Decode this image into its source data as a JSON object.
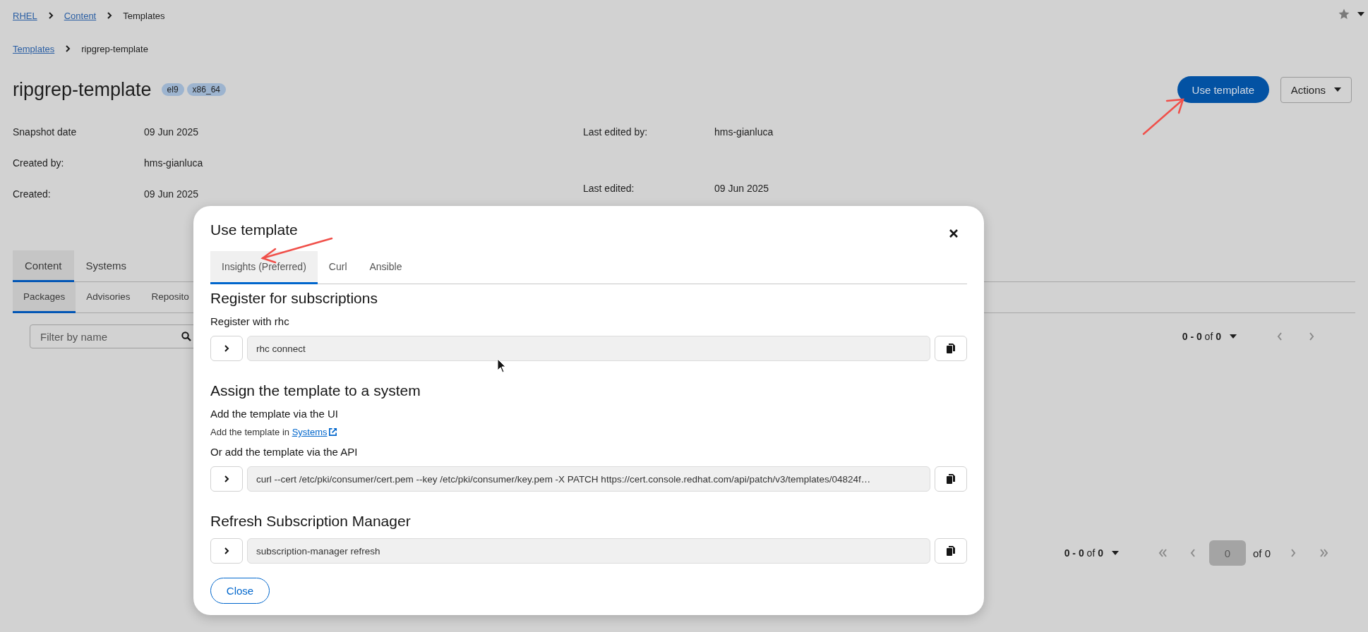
{
  "breadcrumb": [
    {
      "label": "RHEL",
      "link": true
    },
    {
      "label": "Content",
      "link": true
    },
    {
      "label": "Templates",
      "link": false
    }
  ],
  "sub_breadcrumb": [
    {
      "label": "Templates",
      "link": true
    },
    {
      "label": "ripgrep-template",
      "link": false
    }
  ],
  "header": {
    "title": "ripgrep-template",
    "tags": [
      "el9",
      "x86_64"
    ],
    "primary_button": "Use template",
    "actions_button": "Actions"
  },
  "details_left": [
    {
      "label": "Snapshot date",
      "value": "09 Jun 2025"
    },
    {
      "label": "Created by:",
      "value": "hms-gianluca"
    },
    {
      "label": "Created:",
      "value": "09 Jun 2025"
    }
  ],
  "details_right": [
    {
      "label": "Last edited by:",
      "value": "hms-gianluca"
    },
    {
      "label": "Last edited:",
      "value": "09 Jun 2025"
    }
  ],
  "tabs": [
    {
      "label": "Content",
      "selected": true
    },
    {
      "label": "Systems",
      "selected": false
    }
  ],
  "subtabs": [
    {
      "label": "Packages",
      "selected": true
    },
    {
      "label": "Advisories",
      "selected": false
    },
    {
      "label": "Reposito",
      "selected": false
    }
  ],
  "filter": {
    "placeholder": "Filter by name"
  },
  "top_pagination": {
    "range": "**0 - 0** of **0**",
    "buttons": [
      {
        "kind": "prev",
        "disabled": true
      },
      {
        "kind": "next",
        "disabled": true
      }
    ]
  },
  "bottom_pagination": {
    "range": "**0 - 0** of **0**",
    "page": "0",
    "pages": "of 0",
    "buttons": [
      {
        "kind": "first",
        "disabled": true
      },
      {
        "kind": "prev",
        "disabled": true
      },
      {
        "kind": "next",
        "disabled": true
      },
      {
        "kind": "last",
        "disabled": true
      }
    ]
  },
  "modal": {
    "title": "Use template",
    "tabs": [
      {
        "label": "Insights (Preferred)",
        "selected": true
      },
      {
        "label": "Curl",
        "selected": false
      },
      {
        "label": "Ansible",
        "selected": false
      }
    ],
    "sections": [
      {
        "kind": "heading",
        "text": "Register for subscriptions"
      },
      {
        "kind": "subheading",
        "text": "Register with rhc"
      },
      {
        "kind": "code",
        "text": "rhc connect"
      },
      {
        "kind": "heading",
        "text": "Assign the template to a system"
      },
      {
        "kind": "subheading",
        "text": "Add the template via the UI"
      },
      {
        "kind": "text",
        "text": "Add the template in ",
        "link": "Systems"
      },
      {
        "kind": "subheading",
        "text": "Or add the template via the API"
      },
      {
        "kind": "code",
        "text": "curl --cert /etc/pki/consumer/cert.pem  --key /etc/pki/consumer/key.pem -X PATCH https://cert.console.redhat.com/api/patch/v3/templates/04824f…"
      },
      {
        "kind": "heading",
        "text": "Refresh Subscription Manager"
      },
      {
        "kind": "code",
        "text": "subscription-manager refresh"
      }
    ],
    "close_button": "Close"
  }
}
